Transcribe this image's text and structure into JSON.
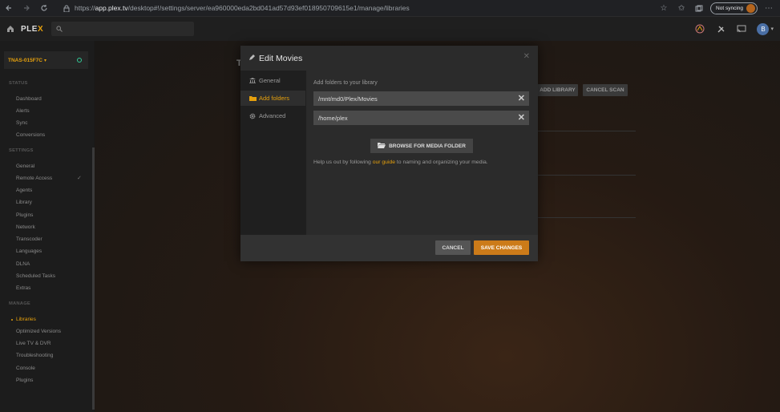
{
  "browser": {
    "url_prefix": "https://",
    "url_domain": "app.plex.tv",
    "url_path": "/desktop#!/settings/server/ea960000eda2bd041ad57d93ef018950709615e1/manage/libraries",
    "sync_label": "Not syncing"
  },
  "topbar": {
    "logo_main": "PLE",
    "logo_accent": "X",
    "user_initial": "B"
  },
  "sidebar": {
    "server_name": "TNAS-015F7C",
    "status_header": "STATUS",
    "status_items": [
      "Dashboard",
      "Alerts",
      "Sync",
      "Conversions"
    ],
    "settings_header": "SETTINGS",
    "settings_items": [
      "General",
      "Remote Access",
      "Agents",
      "Library",
      "Plugins",
      "Network",
      "Transcoder",
      "Languages",
      "DLNA",
      "Scheduled Tasks",
      "Extras"
    ],
    "manage_header": "MANAGE",
    "manage_items": [
      "Libraries",
      "Optimized Versions",
      "Live TV & DVR",
      "Troubleshooting",
      "Console",
      "Plugins"
    ],
    "check_glyph": "✓"
  },
  "background": {
    "title_fragment": "T",
    "add_library": "ADD LIBRARY",
    "cancel_scan": "CANCEL SCAN"
  },
  "modal": {
    "title": "Edit Movies",
    "close_glyph": "✕",
    "tabs": [
      {
        "label": "General"
      },
      {
        "label": "Add folders"
      },
      {
        "label": "Advanced"
      }
    ],
    "add_label": "Add folders to your library",
    "folders": [
      "/mnt/md0/Plex/Movies",
      "/home/plex"
    ],
    "remove_glyph": "✕",
    "browse_label": "BROWSE FOR MEDIA FOLDER",
    "help_before": "Help us out by following ",
    "help_link": "our guide",
    "help_after": " to naming and organizing your media.",
    "cancel_label": "CANCEL",
    "save_label": "SAVE CHANGES"
  },
  "colors": {
    "accent": "#e5a00d",
    "save_button": "#cc7b19",
    "modal_bg": "#282828"
  }
}
